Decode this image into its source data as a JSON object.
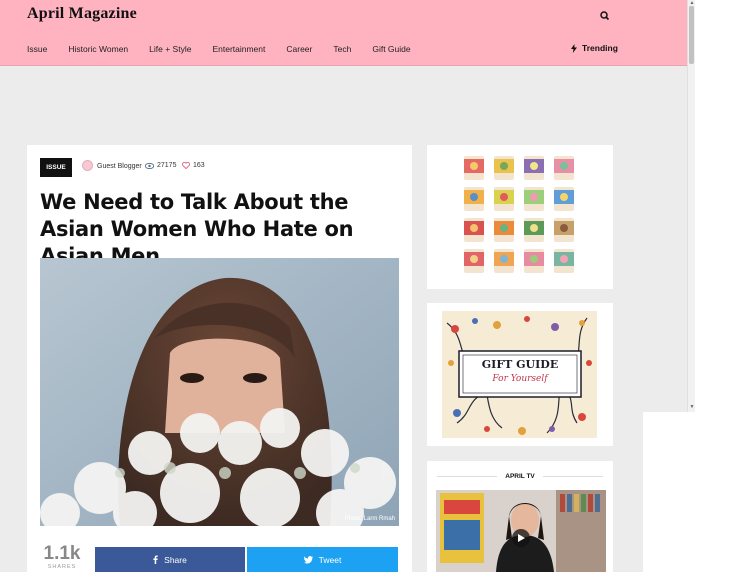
{
  "header": {
    "brand": "April Magazine",
    "nav": [
      "Issue",
      "Historic Women",
      "Life + Style",
      "Entertainment",
      "Career",
      "Tech",
      "Gift Guide"
    ],
    "trending_label": "Trending",
    "search_icon": "search-icon"
  },
  "article": {
    "badge": "ISSUE",
    "author": "Guest Blogger",
    "views": "27175",
    "likes": "163",
    "headline": "We Need to Talk About the Asian Women Who Hate on Asian Men",
    "photo_credit": "Photo: Larm Rmah",
    "share_count": "1.1k",
    "share_label": "SHARES",
    "facebook_label": "Share",
    "twitter_label": "Tweet"
  },
  "sidebar": {
    "tv_title": "APRIL TV",
    "gift_guide_text": "GIFT GUIDE",
    "gift_guide_sub": "For Yourself"
  },
  "colors": {
    "header_bg": "#ffb3c1",
    "facebook": "#3b5998",
    "twitter": "#1da1f2"
  }
}
